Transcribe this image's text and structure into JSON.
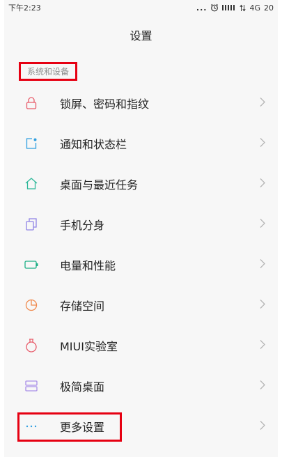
{
  "status_bar": {
    "time": "下午2:23",
    "dots": "...",
    "network": "4G",
    "battery": "20"
  },
  "header": {
    "title": "设置"
  },
  "section": {
    "title": "系统和设备"
  },
  "items": [
    {
      "label": "锁屏、密码和指纹",
      "icon": "lock-icon",
      "color": "#e85b6a"
    },
    {
      "label": "通知和状态栏",
      "icon": "notification-icon",
      "color": "#2f9fe0"
    },
    {
      "label": "桌面与最近任务",
      "icon": "home-icon",
      "color": "#2eb89a"
    },
    {
      "label": "手机分身",
      "icon": "clone-icon",
      "color": "#8f83e6"
    },
    {
      "label": "电量和性能",
      "icon": "battery-icon",
      "color": "#1cae85"
    },
    {
      "label": "存储空间",
      "icon": "storage-icon",
      "color": "#f0894c"
    },
    {
      "label": "MIUI实验室",
      "icon": "lab-flask-icon",
      "color": "#e85b6a"
    },
    {
      "label": "极简桌面",
      "icon": "simple-desktop-icon",
      "color": "#a98ee8"
    },
    {
      "label": "更多设置",
      "icon": "more-icon",
      "color": "#2f9fe0"
    }
  ],
  "colors": {
    "highlight": "#e60012",
    "chevron": "#b5b5b5"
  }
}
